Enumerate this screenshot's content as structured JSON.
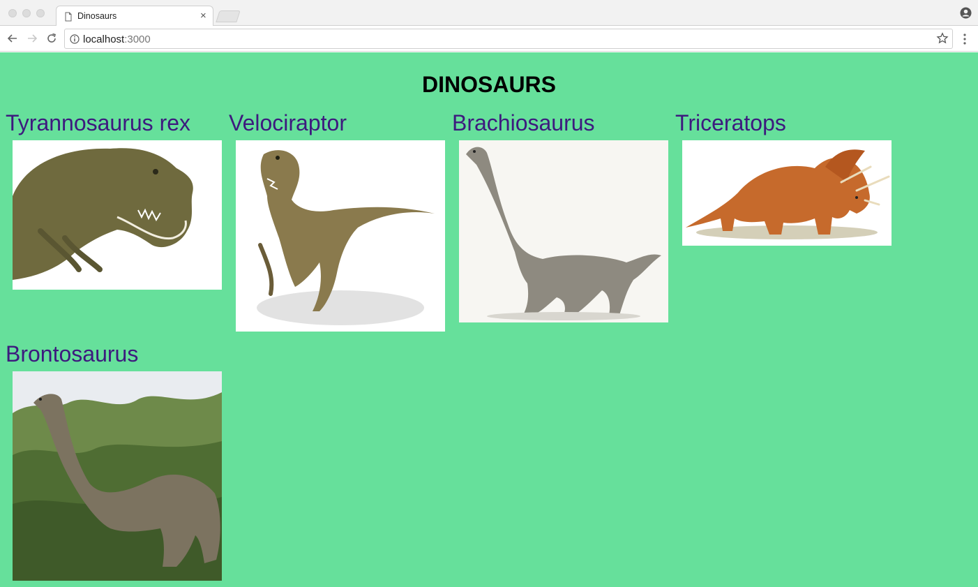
{
  "browser": {
    "tab_title": "Dinosaurs",
    "tab_close": "×",
    "url_host": "localhost",
    "url_port": ":3000"
  },
  "page": {
    "heading": "DINOSAURS",
    "background": "#66e09b",
    "name_color": "#3d1a7e"
  },
  "dinosaurs": [
    {
      "name": "Tyrannosaurus rex",
      "image": "t-rex-photo"
    },
    {
      "name": "Velociraptor",
      "image": "velociraptor-photo"
    },
    {
      "name": "Brachiosaurus",
      "image": "brachiosaurus-photo"
    },
    {
      "name": "Triceratops",
      "image": "triceratops-photo"
    },
    {
      "name": "Brontosaurus",
      "image": "brontosaurus-photo"
    }
  ]
}
